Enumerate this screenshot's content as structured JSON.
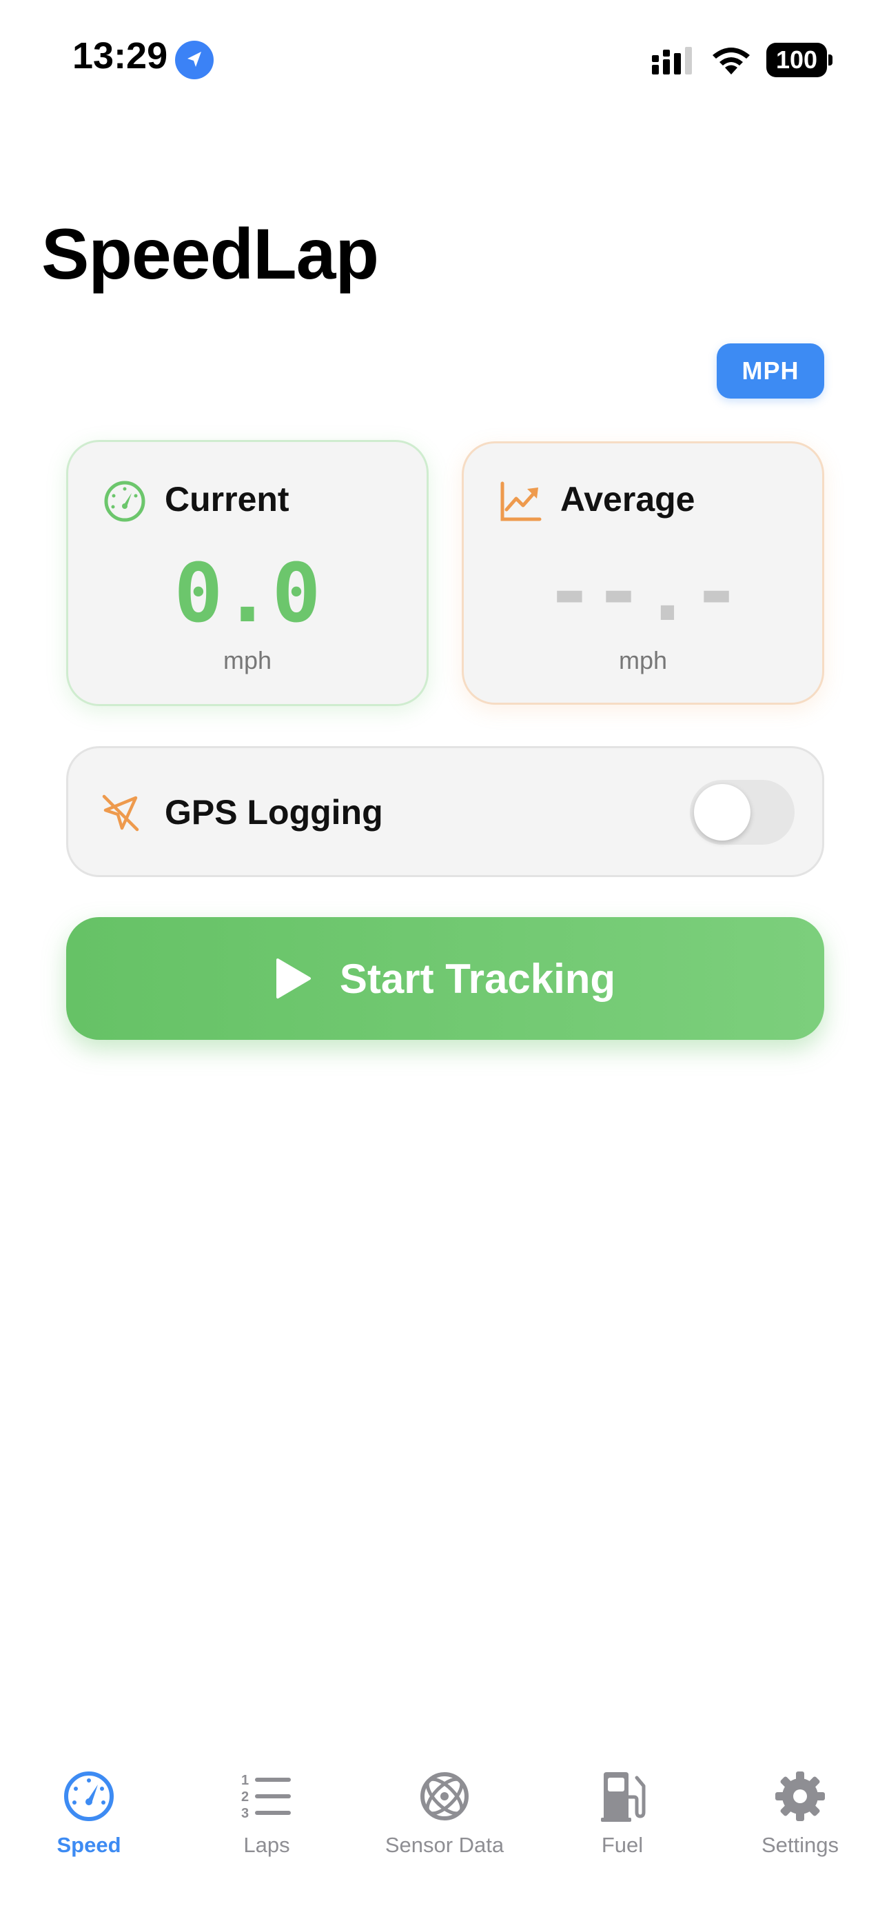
{
  "status_bar": {
    "time": "13:29",
    "battery": "100"
  },
  "app": {
    "title": "SpeedLap"
  },
  "unit_button": {
    "label": "MPH"
  },
  "current_card": {
    "label": "Current",
    "value": "0.0",
    "unit": "mph",
    "icon": "speedometer-icon",
    "color": "#6cc66c"
  },
  "average_card": {
    "label": "Average",
    "value": "--.-",
    "unit": "mph",
    "icon": "trend-chart-icon",
    "color": "#ee9a4d"
  },
  "gps": {
    "label": "GPS Logging",
    "enabled": false,
    "icon": "location-slash-icon"
  },
  "start_button": {
    "label": "Start Tracking",
    "icon": "play-icon"
  },
  "tabs": [
    {
      "label": "Speed",
      "icon": "speedometer-icon",
      "active": true
    },
    {
      "label": "Laps",
      "icon": "numbered-list-icon",
      "active": false
    },
    {
      "label": "Sensor Data",
      "icon": "gyroscope-icon",
      "active": false
    },
    {
      "label": "Fuel",
      "icon": "fuel-pump-icon",
      "active": false
    },
    {
      "label": "Settings",
      "icon": "gear-icon",
      "active": false
    }
  ],
  "colors": {
    "accent": "#3d8bf3",
    "green": "#6cc66c",
    "orange": "#ee9a4d",
    "inactive": "#8e8e93"
  }
}
